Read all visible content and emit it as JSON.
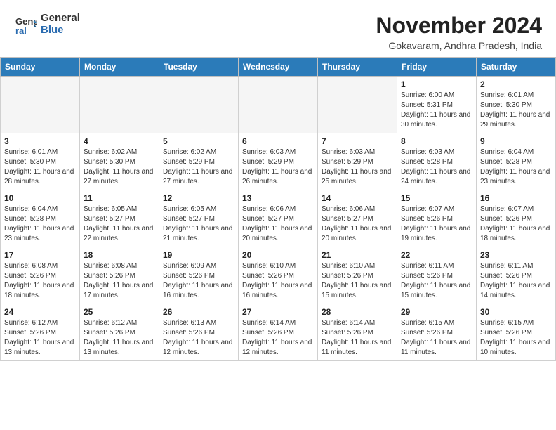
{
  "header": {
    "logo_general": "General",
    "logo_blue": "Blue",
    "month_year": "November 2024",
    "location": "Gokavaram, Andhra Pradesh, India"
  },
  "weekdays": [
    "Sunday",
    "Monday",
    "Tuesday",
    "Wednesday",
    "Thursday",
    "Friday",
    "Saturday"
  ],
  "weeks": [
    [
      {
        "day": "",
        "empty": true
      },
      {
        "day": "",
        "empty": true
      },
      {
        "day": "",
        "empty": true
      },
      {
        "day": "",
        "empty": true
      },
      {
        "day": "",
        "empty": true
      },
      {
        "day": "1",
        "sunrise": "6:00 AM",
        "sunset": "5:31 PM",
        "daylight": "11 hours and 30 minutes."
      },
      {
        "day": "2",
        "sunrise": "6:01 AM",
        "sunset": "5:30 PM",
        "daylight": "11 hours and 29 minutes."
      }
    ],
    [
      {
        "day": "3",
        "sunrise": "6:01 AM",
        "sunset": "5:30 PM",
        "daylight": "11 hours and 28 minutes."
      },
      {
        "day": "4",
        "sunrise": "6:02 AM",
        "sunset": "5:30 PM",
        "daylight": "11 hours and 27 minutes."
      },
      {
        "day": "5",
        "sunrise": "6:02 AM",
        "sunset": "5:29 PM",
        "daylight": "11 hours and 27 minutes."
      },
      {
        "day": "6",
        "sunrise": "6:03 AM",
        "sunset": "5:29 PM",
        "daylight": "11 hours and 26 minutes."
      },
      {
        "day": "7",
        "sunrise": "6:03 AM",
        "sunset": "5:29 PM",
        "daylight": "11 hours and 25 minutes."
      },
      {
        "day": "8",
        "sunrise": "6:03 AM",
        "sunset": "5:28 PM",
        "daylight": "11 hours and 24 minutes."
      },
      {
        "day": "9",
        "sunrise": "6:04 AM",
        "sunset": "5:28 PM",
        "daylight": "11 hours and 23 minutes."
      }
    ],
    [
      {
        "day": "10",
        "sunrise": "6:04 AM",
        "sunset": "5:28 PM",
        "daylight": "11 hours and 23 minutes."
      },
      {
        "day": "11",
        "sunrise": "6:05 AM",
        "sunset": "5:27 PM",
        "daylight": "11 hours and 22 minutes."
      },
      {
        "day": "12",
        "sunrise": "6:05 AM",
        "sunset": "5:27 PM",
        "daylight": "11 hours and 21 minutes."
      },
      {
        "day": "13",
        "sunrise": "6:06 AM",
        "sunset": "5:27 PM",
        "daylight": "11 hours and 20 minutes."
      },
      {
        "day": "14",
        "sunrise": "6:06 AM",
        "sunset": "5:27 PM",
        "daylight": "11 hours and 20 minutes."
      },
      {
        "day": "15",
        "sunrise": "6:07 AM",
        "sunset": "5:26 PM",
        "daylight": "11 hours and 19 minutes."
      },
      {
        "day": "16",
        "sunrise": "6:07 AM",
        "sunset": "5:26 PM",
        "daylight": "11 hours and 18 minutes."
      }
    ],
    [
      {
        "day": "17",
        "sunrise": "6:08 AM",
        "sunset": "5:26 PM",
        "daylight": "11 hours and 18 minutes."
      },
      {
        "day": "18",
        "sunrise": "6:08 AM",
        "sunset": "5:26 PM",
        "daylight": "11 hours and 17 minutes."
      },
      {
        "day": "19",
        "sunrise": "6:09 AM",
        "sunset": "5:26 PM",
        "daylight": "11 hours and 16 minutes."
      },
      {
        "day": "20",
        "sunrise": "6:10 AM",
        "sunset": "5:26 PM",
        "daylight": "11 hours and 16 minutes."
      },
      {
        "day": "21",
        "sunrise": "6:10 AM",
        "sunset": "5:26 PM",
        "daylight": "11 hours and 15 minutes."
      },
      {
        "day": "22",
        "sunrise": "6:11 AM",
        "sunset": "5:26 PM",
        "daylight": "11 hours and 15 minutes."
      },
      {
        "day": "23",
        "sunrise": "6:11 AM",
        "sunset": "5:26 PM",
        "daylight": "11 hours and 14 minutes."
      }
    ],
    [
      {
        "day": "24",
        "sunrise": "6:12 AM",
        "sunset": "5:26 PM",
        "daylight": "11 hours and 13 minutes."
      },
      {
        "day": "25",
        "sunrise": "6:12 AM",
        "sunset": "5:26 PM",
        "daylight": "11 hours and 13 minutes."
      },
      {
        "day": "26",
        "sunrise": "6:13 AM",
        "sunset": "5:26 PM",
        "daylight": "11 hours and 12 minutes."
      },
      {
        "day": "27",
        "sunrise": "6:14 AM",
        "sunset": "5:26 PM",
        "daylight": "11 hours and 12 minutes."
      },
      {
        "day": "28",
        "sunrise": "6:14 AM",
        "sunset": "5:26 PM",
        "daylight": "11 hours and 11 minutes."
      },
      {
        "day": "29",
        "sunrise": "6:15 AM",
        "sunset": "5:26 PM",
        "daylight": "11 hours and 11 minutes."
      },
      {
        "day": "30",
        "sunrise": "6:15 AM",
        "sunset": "5:26 PM",
        "daylight": "11 hours and 10 minutes."
      }
    ]
  ]
}
